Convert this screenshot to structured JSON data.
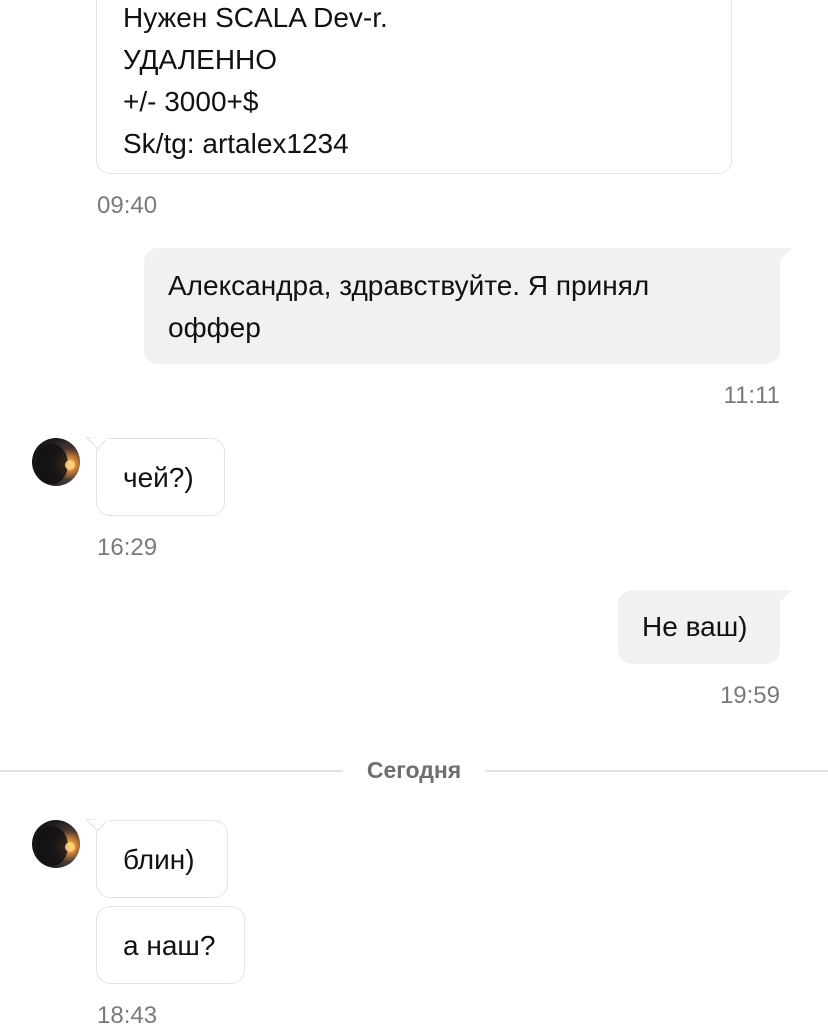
{
  "messages": [
    {
      "direction": "incoming",
      "lines": [
        "Нужен SCALA Dev-r.",
        "УДАЛЕННО",
        "+/- 3000+$",
        "Sk/tg: artalex1234"
      ],
      "time": "09:40"
    },
    {
      "direction": "outgoing",
      "lines": [
        "Александра, здравствуйте. Я принял",
        "оффер"
      ],
      "time": "11:11"
    },
    {
      "direction": "incoming",
      "lines": [
        "чей?)"
      ],
      "time": "16:29"
    },
    {
      "direction": "outgoing",
      "lines": [
        "Не ваш)"
      ],
      "time": "19:59"
    },
    {
      "direction": "incoming",
      "lines": [
        "блин)"
      ],
      "time": ""
    },
    {
      "direction": "incoming",
      "lines": [
        "а наш?"
      ],
      "time": "18:43"
    }
  ],
  "divider": {
    "label": "Сегодня"
  },
  "avatar": {
    "icon": "contact-avatar-photo"
  }
}
